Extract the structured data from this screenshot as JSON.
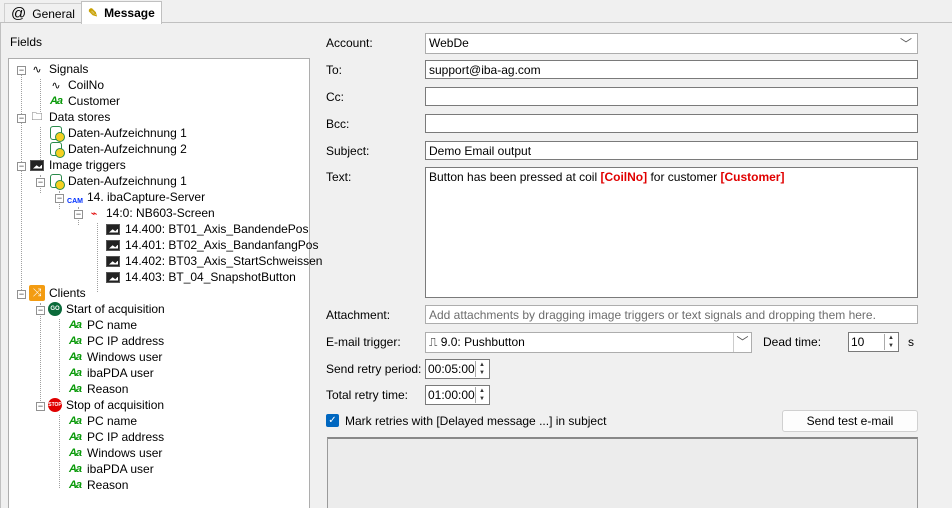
{
  "tabs": [
    {
      "label": "General",
      "icon": "at-icon"
    },
    {
      "label": "Message",
      "icon": "edit-icon",
      "active": true
    }
  ],
  "fields_label": "Fields",
  "tree": {
    "signals": "Signals",
    "coilno": "CoilNo",
    "customer": "Customer",
    "datastores": "Data stores",
    "ds1": "Daten-Aufzeichnung 1",
    "ds2": "Daten-Aufzeichnung 2",
    "imagetriggers": "Image triggers",
    "it_ds1": "Daten-Aufzeichnung 1",
    "capture": "14. ibaCapture-Server",
    "screen": "14:0: NB603-Screen",
    "images": [
      "14.400: BT01_Axis_BandendePos",
      "14.401: BT02_Axis_BandanfangPos",
      "14.402: BT03_Axis_StartSchweissen",
      "14.403: BT_04_SnapshotButton"
    ],
    "clients": "Clients",
    "start": "Start of acquisition",
    "stop": "Stop of acquisition",
    "client_fields": [
      "PC name",
      "PC IP address",
      "Windows user",
      "ibaPDA user",
      "Reason"
    ]
  },
  "form": {
    "account_label": "Account:",
    "account": "WebDe",
    "to_label": "To:",
    "to": "support@iba-ag.com",
    "cc_label": "Cc:",
    "cc": "",
    "bcc_label": "Bcc:",
    "bcc": "",
    "subject_label": "Subject:",
    "subject": "Demo Email output",
    "text_label": "Text:",
    "text_pre": "Button has been pressed at coil ",
    "text_f1": "[CoilNo]",
    "text_mid": " for customer ",
    "text_f2": "[Customer]",
    "attachment_label": "Attachment:",
    "attachment_placeholder": "Add attachments by dragging image triggers or text signals and dropping them here.",
    "trigger_label": "E-mail trigger:",
    "trigger": "9.0: Pushbutton",
    "dead_label": "Dead time:",
    "dead": "10",
    "dead_unit": "s",
    "retry_label": "Send retry period:",
    "retry": "00:05:00",
    "total_label": "Total retry time:",
    "total": "01:00:00",
    "mark_label": "Mark retries with [Delayed message ...] in subject",
    "mark_checked": true,
    "send_test": "Send test e-mail"
  },
  "colors": {
    "accent": "#0067c0",
    "field_highlight": "#e00000"
  }
}
